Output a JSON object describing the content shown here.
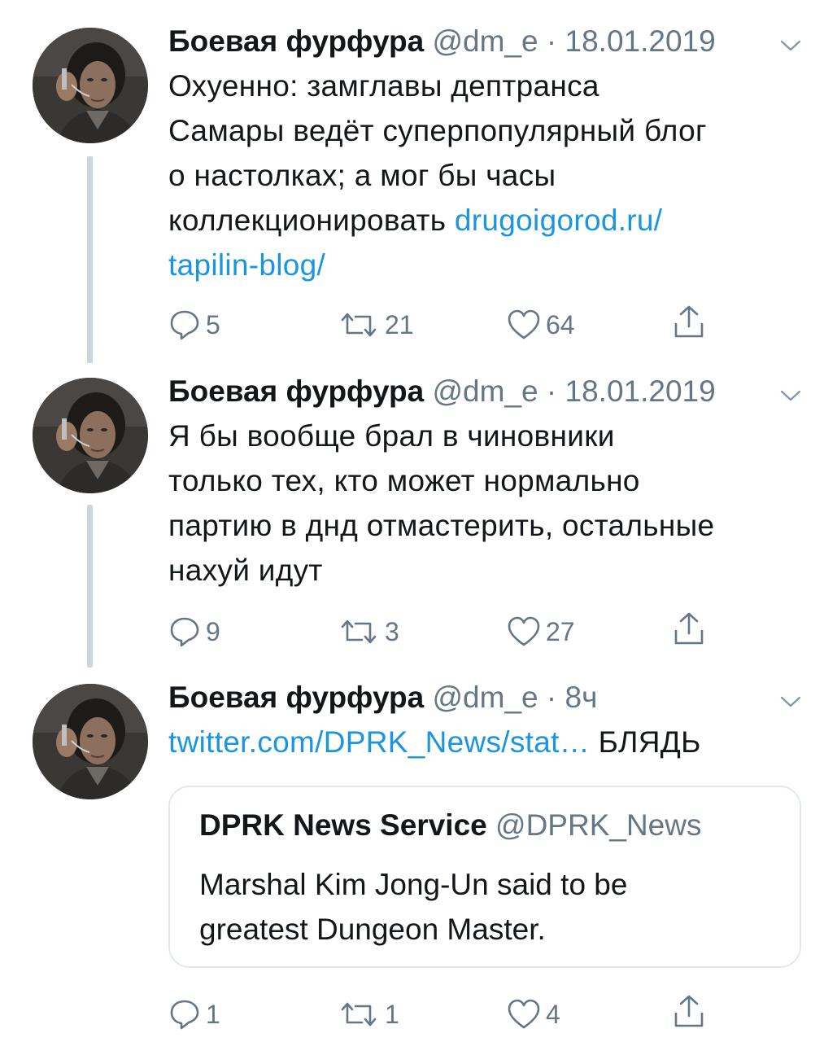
{
  "tweets": [
    {
      "name": "Боевая фурфура",
      "handle": "@dm_e",
      "dot": "·",
      "time": "18.01.2019",
      "lines": [
        "Охуенно: замглавы дептранса",
        "Самары ведёт суперпопулярный блог",
        "о настолках; а мог бы часы"
      ],
      "line4_text": "коллекционировать ",
      "link_part1": "drugoigorod.ru/",
      "link_part2": "tapilin-blog/",
      "replies": "5",
      "retweets": "21",
      "likes": "64"
    },
    {
      "name": "Боевая фурфура",
      "handle": "@dm_e",
      "dot": "·",
      "time": "18.01.2019",
      "lines": [
        "Я бы вообще брал в чиновники",
        "только тех, кто может нормально",
        "партию в днд отмастерить, остальные",
        "нахуй идут"
      ],
      "replies": "9",
      "retweets": "3",
      "likes": "27"
    },
    {
      "name": "Боевая фурфура",
      "handle": "@dm_e",
      "dot": "·",
      "time": "8ч",
      "link": "twitter.com/DPRK_News/stat…",
      "text_after_link": " БЛЯДЬ",
      "quote": {
        "name": "DPRK News Service",
        "handle": "@DPRK_News",
        "lines": [
          "Marshal Kim Jong-Un said to be",
          "greatest Dungeon Master."
        ]
      },
      "replies": "1",
      "retweets": "1",
      "likes": "4"
    }
  ],
  "icons": {
    "reply": "reply-icon",
    "retweet": "retweet-icon",
    "like": "heart-icon",
    "share": "share-icon",
    "menu": "chevron-down-icon"
  },
  "colors": {
    "link": "#1b95e0",
    "secondary": "#657786",
    "thread_line": "#ccd6dd",
    "border": "#e1e8ed"
  }
}
